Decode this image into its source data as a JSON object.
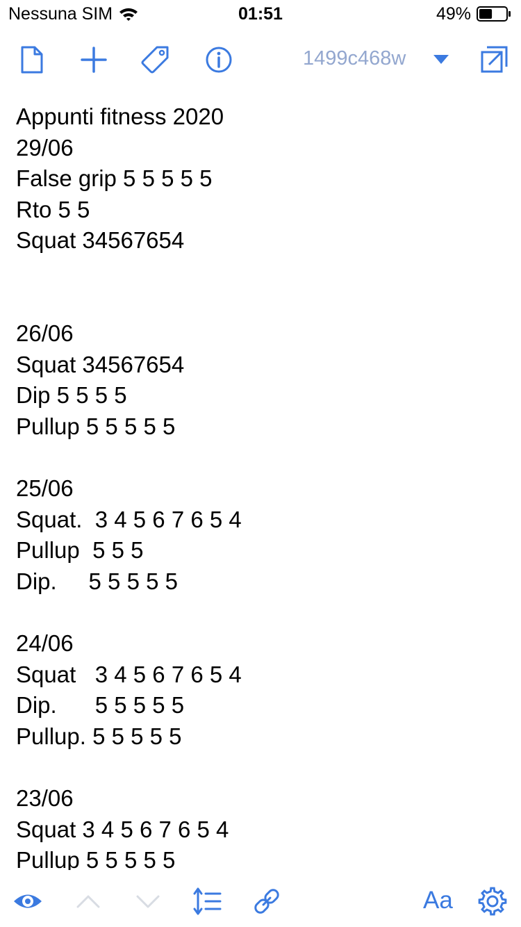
{
  "status_bar": {
    "carrier": "Nessuna SIM",
    "time": "01:51",
    "battery_percent": "49%",
    "battery_level": 0.49
  },
  "toolbar": {
    "icons": [
      "document-icon",
      "plus-icon",
      "tag-icon",
      "info-icon",
      "external-window-icon"
    ],
    "note_name": "1499c468w"
  },
  "note": {
    "lines": [
      "Appunti fitness 2020",
      "29/06",
      "False grip 5 5 5 5 5",
      "Rto 5 5",
      "Squat 34567654",
      "",
      "",
      "26/06",
      "Squat 34567654",
      "Dip 5 5 5 5",
      "Pullup 5 5 5 5 5",
      "",
      "25/06",
      "Squat.  3 4 5 6 7 6 5 4",
      "Pullup  5 5 5",
      "Dip.     5 5 5 5 5",
      "",
      "24/06",
      "Squat   3 4 5 6 7 6 5 4",
      "Dip.      5 5 5 5 5",
      "Pullup. 5 5 5 5 5",
      "",
      "23/06",
      "Squat 3 4 5 6 7 6 5 4",
      "Pullup 5 5 5 5 5"
    ]
  },
  "bottom_bar": {
    "icons": [
      "eye-icon",
      "chevron-up-icon",
      "chevron-down-icon",
      "line-spacing-icon",
      "link-icon",
      "gear-icon"
    ],
    "font_label": "Aa"
  },
  "colors": {
    "accent": "#3b7ae0",
    "note_name": "#93a7cf",
    "disabled": "#d8dce3"
  }
}
